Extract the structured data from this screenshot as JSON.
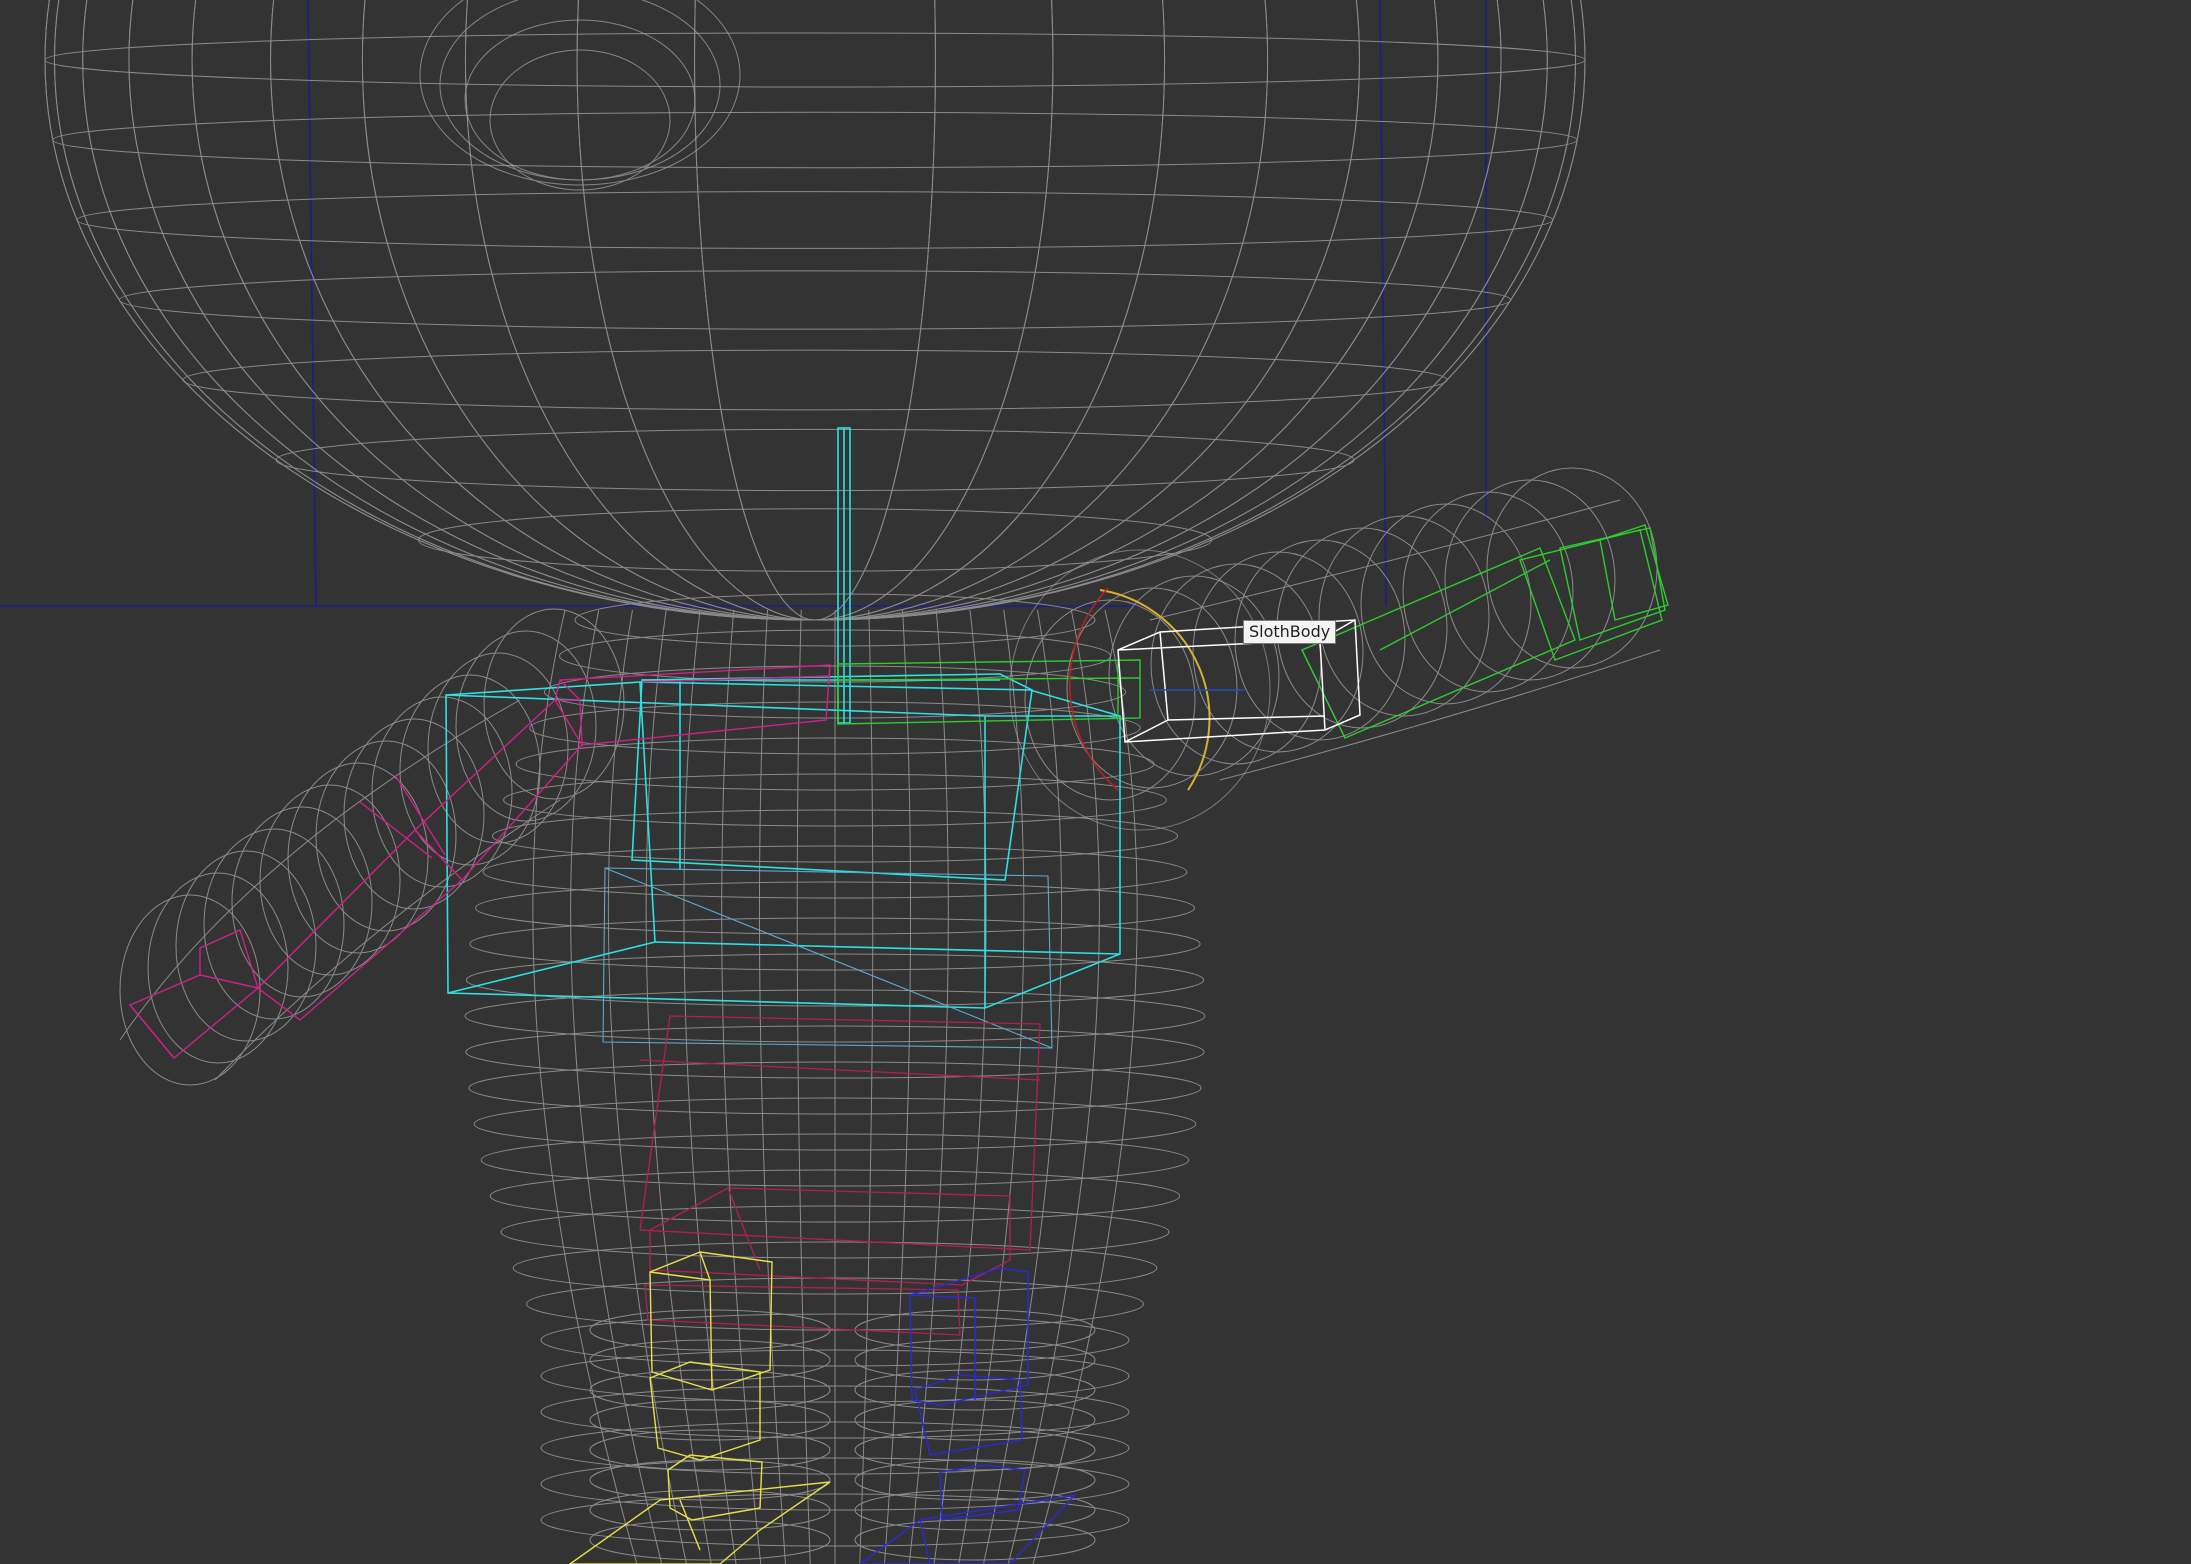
{
  "viewport": {
    "background": "#333333",
    "mesh_color": "#a9a9a9",
    "grid_color": "#1c1c8c"
  },
  "tooltip": {
    "label": "SlothBody"
  },
  "rig": {
    "spine_color": "#2ee0e0",
    "left_arm_color": "#d0208a",
    "right_arm_color": "#2ecc2e",
    "hips_color": "#b3204f",
    "left_leg_color": "#e8e04a",
    "right_leg_color": "#2a2ad8",
    "selected_color": "#ffffff",
    "rotate_gizmo_color": "#d8b030"
  }
}
